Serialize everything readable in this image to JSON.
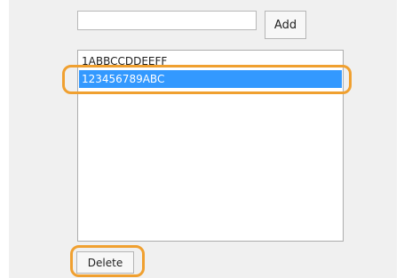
{
  "form": {
    "input_value": "",
    "add_label": "Add",
    "delete_label": "Delete"
  },
  "list": {
    "items": [
      {
        "label": "1ABBCCDDEEFF",
        "selected": false
      },
      {
        "label": "123456789ABC",
        "selected": true
      }
    ]
  },
  "colors": {
    "selection": "#3399ff",
    "highlight": "#f0a030",
    "panel_bg": "#f0f0f0"
  }
}
